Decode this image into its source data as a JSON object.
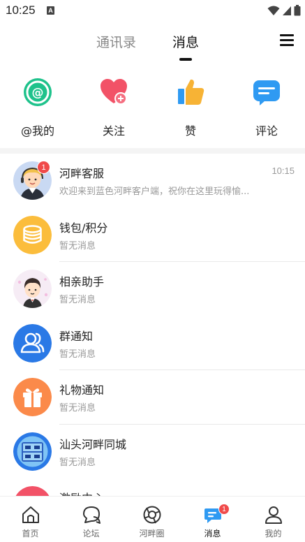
{
  "status_bar": {
    "time": "10:25",
    "notification_icon": "A"
  },
  "header": {
    "tabs": [
      {
        "label": "通讯录",
        "active": false
      },
      {
        "label": "消息",
        "active": true
      }
    ],
    "menu_icon": "hamburger-menu-icon"
  },
  "quick_actions": [
    {
      "label": "@我的",
      "icon": "at-icon",
      "color": "#1ec28b"
    },
    {
      "label": "关注",
      "icon": "heart-plus-icon",
      "color": "#f25267"
    },
    {
      "label": "赞",
      "icon": "thumbs-up-icon",
      "color": "#f7b335"
    },
    {
      "label": "评论",
      "icon": "comment-icon",
      "color": "#2f9af2"
    }
  ],
  "messages": [
    {
      "title": "河畔客服",
      "subtitle": "欢迎来到蓝色河畔客户端，祝你在这里玩得愉...",
      "time": "10:15",
      "badge": "1",
      "avatar": "customer-service-avatar"
    },
    {
      "title": "钱包/积分",
      "subtitle": "暂无消息",
      "avatar": "coins-icon",
      "color": "#fbbd3c"
    },
    {
      "title": "相亲助手",
      "subtitle": "暂无消息",
      "avatar": "matchmaker-avatar"
    },
    {
      "title": "群通知",
      "subtitle": "暂无消息",
      "avatar": "group-icon",
      "color": "#2a79e6"
    },
    {
      "title": "礼物通知",
      "subtitle": "暂无消息",
      "avatar": "gift-icon",
      "color": "#fb8a4a"
    },
    {
      "title": "汕头河畔同城",
      "subtitle": "暂无消息",
      "avatar": "same-city-helper-avatar"
    },
    {
      "title": "激励中心",
      "subtitle": "",
      "avatar": "incentive-icon",
      "color": "#f25267"
    }
  ],
  "bottom_nav": [
    {
      "label": "首页",
      "icon": "home-icon",
      "active": false
    },
    {
      "label": "论坛",
      "icon": "forum-icon",
      "active": false
    },
    {
      "label": "河畔圈",
      "icon": "camera-aperture-icon",
      "active": false
    },
    {
      "label": "消息",
      "icon": "message-icon",
      "active": true,
      "badge": "1"
    },
    {
      "label": "我的",
      "icon": "profile-icon",
      "active": false
    }
  ]
}
